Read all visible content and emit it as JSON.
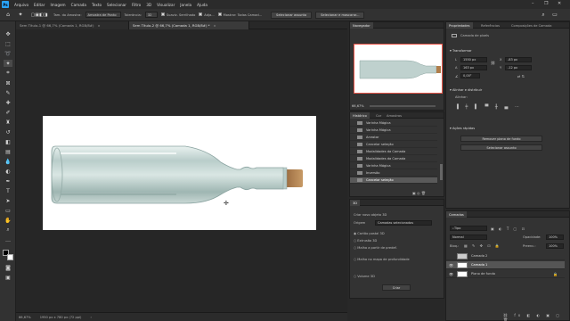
{
  "app": {
    "logo": "Ps",
    "menu": [
      "Arquivo",
      "Editar",
      "Imagem",
      "Camada",
      "Texto",
      "Selecionar",
      "Filtro",
      "3D",
      "Visualizar",
      "Janela",
      "Ajuda"
    ],
    "window_controls": [
      "–",
      "❐",
      "✕"
    ]
  },
  "options_bar": {
    "mode_label": "Tam. do Amostra:",
    "mode_value": "Amostra de Ponto",
    "tolerance_label": "Tolerância:",
    "tolerance_value": "32",
    "antialias_label": "Suaviz. Serrilhado",
    "contiguous_label": "Adja...",
    "sample_all_label": "Mostrar: Todas Camad...",
    "select_subject_btn": "Selecionar assunto",
    "select_mask_btn": "Selecionar e mascarar..."
  },
  "tabs": [
    {
      "label": "Sem Título-1 @ 66,7% (Camada 1, RGB/8#)",
      "active": false
    },
    {
      "label": "Sem Título-2 @ 66,7% (Camada 1, RGB/8#) *",
      "active": true
    }
  ],
  "status": {
    "zoom": "66,67%",
    "doc_size": "1950 px x 780 px (72 ppi)"
  },
  "navigator": {
    "title": "Navegador",
    "zoom": "66,67%"
  },
  "history": {
    "tabs": [
      "Histórico",
      "Cor",
      "Amostras"
    ],
    "items": [
      {
        "label": "Varinha Mágica",
        "selected": false
      },
      {
        "label": "Varinha Mágica",
        "selected": false
      },
      {
        "label": "Arrastar",
        "selected": false
      },
      {
        "label": "Cancelar seleção",
        "selected": false
      },
      {
        "label": "Modalidades da Camada",
        "selected": false
      },
      {
        "label": "Modalidades da Camada",
        "selected": false
      },
      {
        "label": "Varinha Mágica",
        "selected": false
      },
      {
        "label": "Inversão",
        "selected": false
      },
      {
        "label": "Cancelar seleção",
        "selected": true
      }
    ]
  },
  "three_d": {
    "tab": "3D",
    "source_label": "Criar novo objeto 3D",
    "source_field_label": "Origem",
    "source_value": "Camadas selecionadas",
    "options": [
      "Cartão postal 3D",
      "Extrusão 3D",
      "Malha a partir de predef.",
      "Malha no mapa de profundidade",
      "Volume 3D"
    ],
    "create_btn": "Criar"
  },
  "properties": {
    "tabs": [
      "Propriedades",
      "Referências",
      "Composições de Camada"
    ],
    "type_label": "Camada de pixels",
    "transform_title": "Transformar",
    "w_label": "L",
    "w_value": "1550 px",
    "h_label": "A",
    "h_value": "163 px",
    "x_label": "X",
    "x_value": "-83 px",
    "y_label": "Y",
    "y_value": "-12 px",
    "angle_value": "0,00°",
    "align_title": "Alinhar e distribuir",
    "align_sub": "Alinhar:",
    "quick_title": "Ações rápidas",
    "quick_btn1": "Remover plano de fundo",
    "quick_btn2": "Selecionar assunto"
  },
  "layers": {
    "title": "Camadas",
    "filter_value": "Tipo",
    "blend_value": "Normal",
    "opacity_label": "Opacidade:",
    "opacity_value": "100%",
    "lock_label": "Bloq.:",
    "fill_label": "Preenc.:",
    "fill_value": "100%",
    "rows": [
      {
        "name": "Camada 2",
        "selected": false,
        "visible": false
      },
      {
        "name": "Camada 1",
        "selected": true,
        "visible": true
      },
      {
        "name": "Plano de fundo",
        "selected": false,
        "visible": true
      }
    ]
  },
  "colors": {
    "accent_red": "#e8564a",
    "panel": "#333333",
    "workspace": "#262626"
  }
}
